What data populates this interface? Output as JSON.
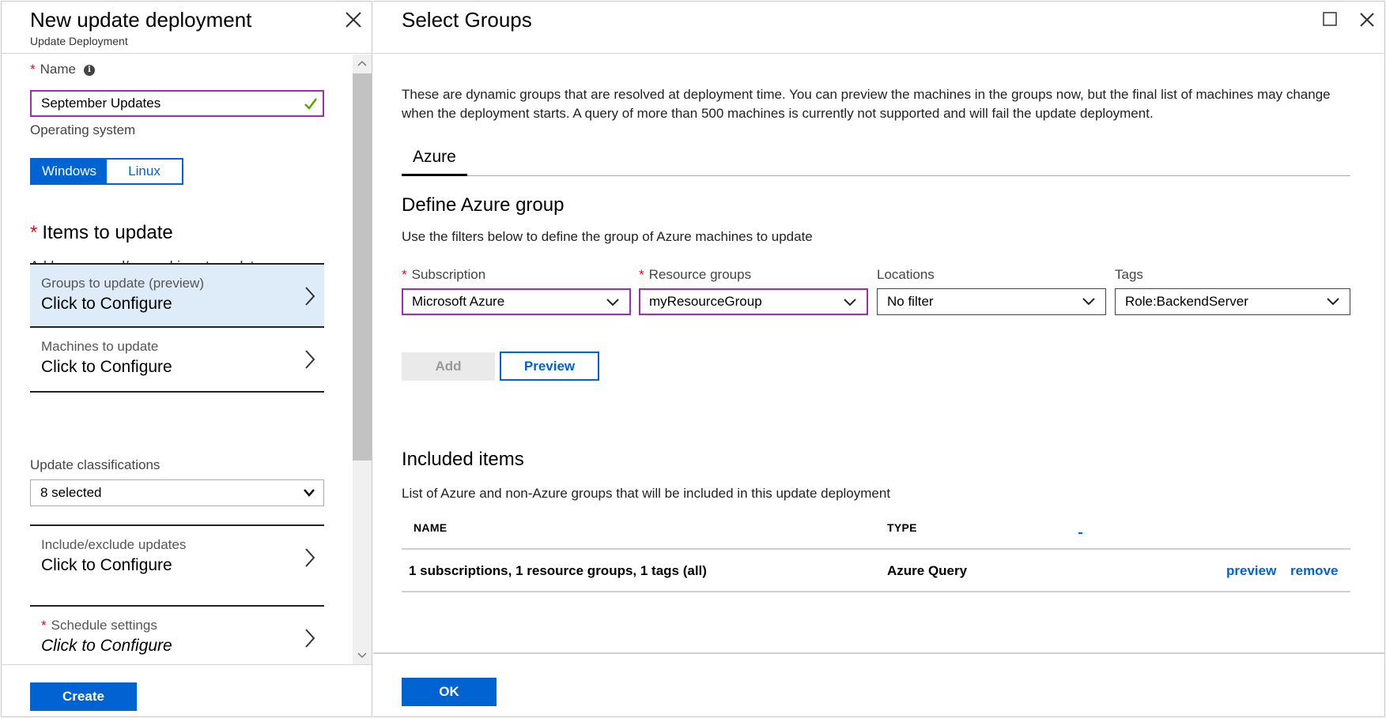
{
  "left_blade": {
    "title": "New update deployment",
    "subtitle": "Update Deployment",
    "name_field": {
      "label": "Name",
      "value": "September Updates"
    },
    "os": {
      "label": "Operating system",
      "options": [
        "Windows",
        "Linux"
      ],
      "selected": "Windows"
    },
    "items_to_update": {
      "title": "Items to update",
      "description": "Add groups and/or machines to update"
    },
    "groups_item": {
      "label": "Groups to update (preview)",
      "value": "Click to Configure"
    },
    "machines_item": {
      "label": "Machines to update",
      "value": "Click to Configure"
    },
    "classifications": {
      "label": "Update classifications",
      "value": "8 selected"
    },
    "include_exclude_item": {
      "label": "Include/exclude updates",
      "value": "Click to Configure"
    },
    "schedule_item": {
      "label": "Schedule settings",
      "value": "Click to Configure"
    },
    "create_label": "Create"
  },
  "right_blade": {
    "title": "Select Groups",
    "intro": "These are dynamic groups that are resolved at deployment time. You can preview the machines in the groups now, but the final list of machines may change when the deployment starts. A query of more than 500 machines is currently not supported and will fail the update deployment.",
    "tabs": [
      {
        "label": "Azure",
        "active": true
      }
    ],
    "define": {
      "title": "Define Azure group",
      "description": "Use the filters below to define the group of Azure machines to update"
    },
    "filters": [
      {
        "label": "Subscription",
        "required": true,
        "value": "Microsoft Azure"
      },
      {
        "label": "Resource groups",
        "required": true,
        "value": "myResourceGroup"
      },
      {
        "label": "Locations",
        "required": false,
        "value": "No filter"
      },
      {
        "label": "Tags",
        "required": false,
        "value": "Role:BackendServer"
      }
    ],
    "add_label": "Add",
    "preview_label": "Preview",
    "included": {
      "title": "Included items",
      "description": "List of Azure and non-Azure groups that will be included in this update deployment",
      "columns": [
        "NAME",
        "TYPE"
      ],
      "rows": [
        {
          "name": "1 subscriptions, 1 resource groups, 1 tags (all)",
          "type": "Azure Query",
          "actions": [
            "preview",
            "remove"
          ]
        }
      ]
    },
    "ok_label": "OK"
  },
  "colors": {
    "accent": "#0063d1",
    "invalid_border": "#9b2fae",
    "required": "#e00b1c",
    "highlight": "#deecf9",
    "valid_check": "#57a300"
  }
}
